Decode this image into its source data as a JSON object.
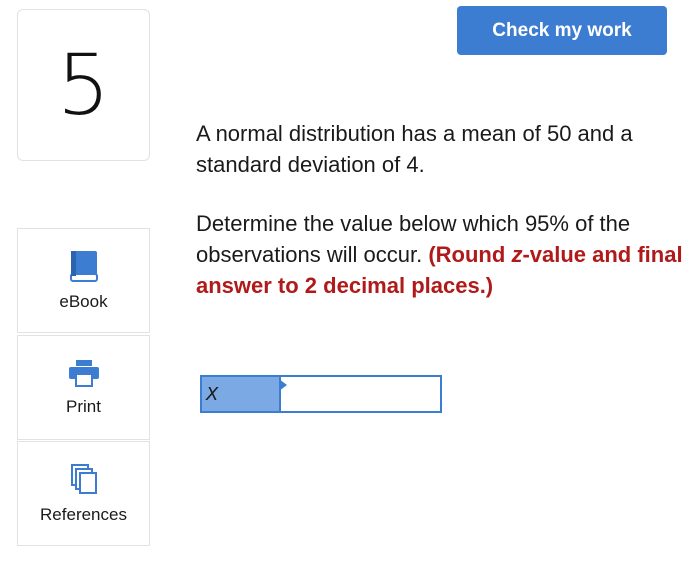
{
  "question": {
    "number": "5",
    "paragraph1": "A normal distribution has a mean of 50 and a standard deviation of 4.",
    "paragraph2": "Determine the value below which 95% of the observations will occur.",
    "instruction_prefix": "(Round ",
    "instruction_italic": "z",
    "instruction_suffix": "-value and final answer to 2 decimal places.)"
  },
  "toolbar": {
    "check_label": "Check my work"
  },
  "resources": [
    {
      "label": "eBook",
      "icon": "book-icon"
    },
    {
      "label": "Print",
      "icon": "printer-icon"
    },
    {
      "label": "References",
      "icon": "copy-icon"
    }
  ],
  "answer": {
    "variable": "X",
    "value": ""
  },
  "colors": {
    "accent": "#3d7dd1",
    "variable_cell": "#7ba9e3",
    "instruction": "#b01a1a"
  }
}
